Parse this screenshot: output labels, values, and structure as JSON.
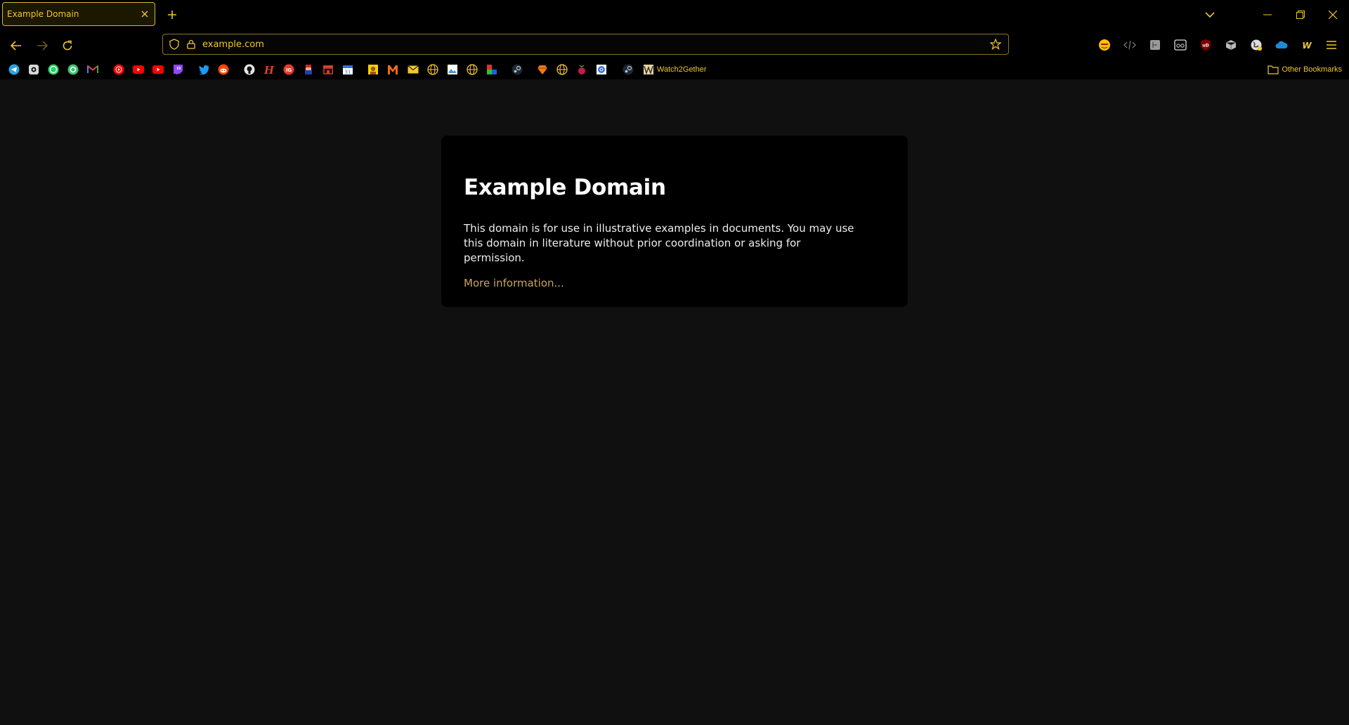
{
  "tab": {
    "title": "Example Domain"
  },
  "address_bar": {
    "url": "example.com"
  },
  "bookmarks": {
    "items": [
      {
        "icon": "telegram-icon",
        "color": "#2aa3e0"
      },
      {
        "icon": "camera-icon",
        "color": "#d8d8d8"
      },
      {
        "icon": "whatsapp-icon",
        "color": "#25d366"
      },
      {
        "icon": "circle-app-icon",
        "color": "#3fbf6f"
      },
      {
        "icon": "gmail-icon",
        "color": "#ea4335"
      },
      {
        "icon": "youtube-music-icon",
        "color": "#ff0000"
      },
      {
        "icon": "youtube-icon",
        "color": "#ff0000"
      },
      {
        "icon": "youtube-icon",
        "color": "#ff0000"
      },
      {
        "icon": "twitch-icon",
        "color": "#9146ff"
      },
      {
        "icon": "twitter-icon",
        "color": "#1d9bf0"
      },
      {
        "icon": "reddit-icon",
        "color": "#ff4500"
      },
      {
        "icon": "github-icon",
        "color": "#e6e6e6"
      },
      {
        "icon": "h-icon",
        "color": "#e8392c"
      },
      {
        "icon": "ig-icon",
        "color": "#e8392c"
      },
      {
        "icon": "mario-icon",
        "color": "#e0622a"
      },
      {
        "icon": "store-icon",
        "color": "#e0392c"
      },
      {
        "icon": "calendar-icon",
        "color": "#3a6fd8"
      },
      {
        "icon": "character-icon",
        "color": "#f2d000"
      },
      {
        "icon": "m-icon",
        "color": "#f06a1a"
      },
      {
        "icon": "mail-icon",
        "color": "#f2c62c"
      },
      {
        "icon": "globe-icon",
        "color": "#f2c62c"
      },
      {
        "icon": "photos-icon",
        "color": "#4a90d9"
      },
      {
        "icon": "globe-icon",
        "color": "#f2c62c"
      },
      {
        "icon": "rgb-icon",
        "color": "#e03030"
      },
      {
        "icon": "steam-icon",
        "color": "#c8c8c8"
      },
      {
        "icon": "diamond-icon",
        "color": "#f07a1a"
      },
      {
        "icon": "globe-icon",
        "color": "#f2c62c"
      },
      {
        "icon": "raspberry-icon",
        "color": "#c51a4a"
      },
      {
        "icon": "kubernetes-icon",
        "color": "#326ce5"
      },
      {
        "icon": "steam-icon",
        "color": "#c8c8c8"
      }
    ],
    "watch2gether_label": "Watch2Gether",
    "other_bookmarks_label": "Other Bookmarks"
  },
  "page": {
    "title": "Example Domain",
    "paragraph": "This domain is for use in illustrative examples in documents. You may use this domain in literature without prior coordination or asking for permission.",
    "link": "More information..."
  },
  "colors": {
    "accent": "#f2c62c",
    "link": "#c7a55d",
    "card_bg": "#000000",
    "page_bg": "#101010"
  }
}
